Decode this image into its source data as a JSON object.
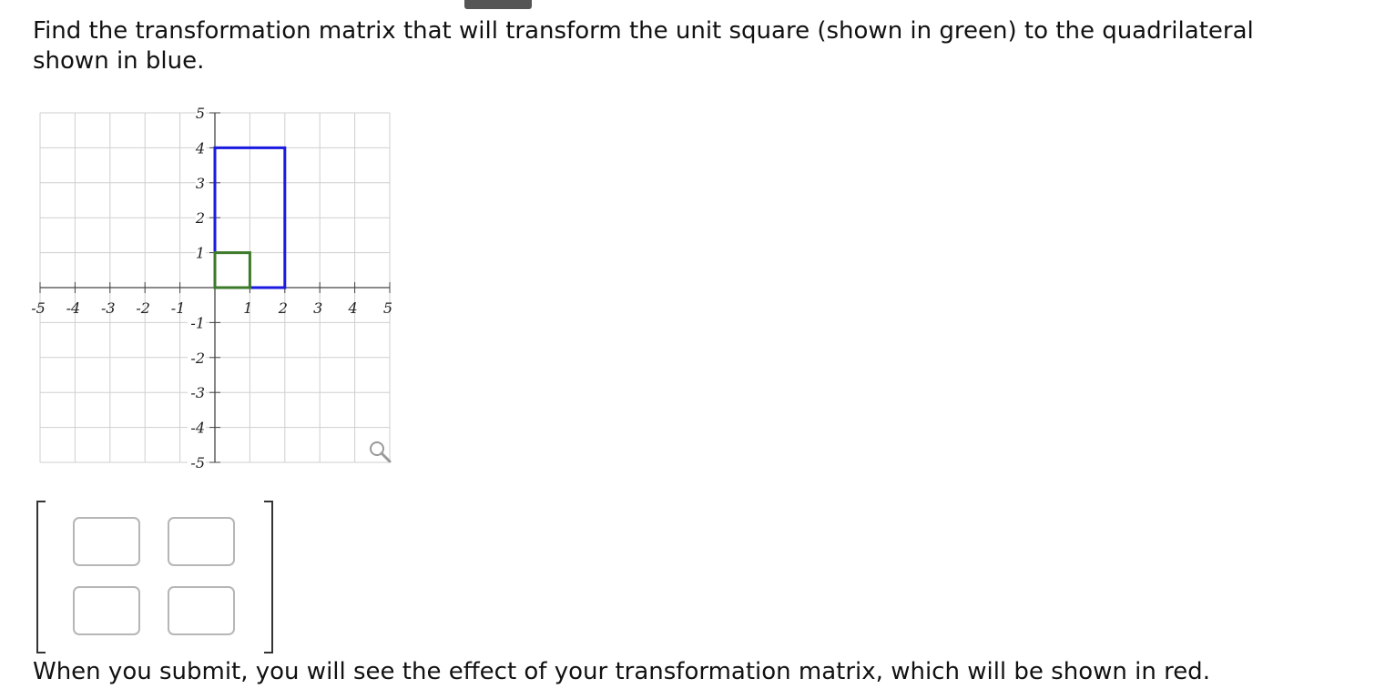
{
  "question": {
    "text": "Find the transformation matrix that will transform the unit square (shown in green) to the quadrilateral shown in blue."
  },
  "graph": {
    "x_range": [
      -5,
      5
    ],
    "y_range": [
      -5,
      5
    ],
    "x_tick_labels": [
      "-5",
      "-4",
      "-3",
      "-2",
      "-1",
      "1",
      "2",
      "3",
      "4",
      "5"
    ],
    "y_tick_labels": [
      "5",
      "4",
      "3",
      "2",
      "1",
      "-1",
      "-2",
      "-3",
      "-4",
      "-5"
    ],
    "grid": true,
    "unit_square": {
      "color": "#3c7a2a",
      "vertices": [
        [
          0,
          0
        ],
        [
          1,
          0
        ],
        [
          1,
          1
        ],
        [
          0,
          1
        ]
      ]
    },
    "target_quadrilateral": {
      "color": "#1a1ae0",
      "vertices": [
        [
          0,
          0
        ],
        [
          2,
          0
        ],
        [
          2,
          4
        ],
        [
          0,
          4
        ]
      ]
    },
    "zoom_icon": "magnifier-icon"
  },
  "matrix": {
    "cells": [
      {
        "value": "",
        "placeholder": ""
      },
      {
        "value": "",
        "placeholder": ""
      },
      {
        "value": "",
        "placeholder": ""
      },
      {
        "value": "",
        "placeholder": ""
      }
    ]
  },
  "note": {
    "text": "When you submit, you will see the effect of your transformation matrix, which will be shown in red."
  }
}
